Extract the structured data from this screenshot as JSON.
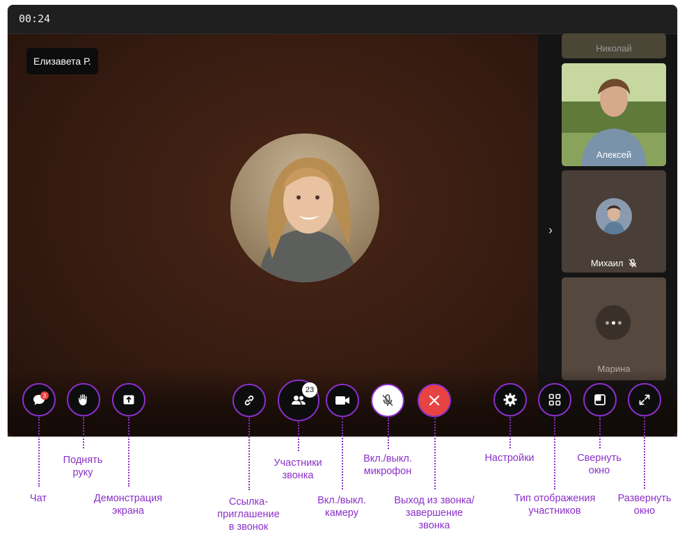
{
  "call": {
    "timer": "00:24",
    "active_speaker": "Елизавета Р."
  },
  "participants": [
    {
      "name": "Николай",
      "view": "video"
    },
    {
      "name": "Алексей",
      "view": "video"
    },
    {
      "name": "Михаил",
      "view": "avatar",
      "muted": true
    },
    {
      "name": "Марина",
      "view": "connecting"
    }
  ],
  "controls": {
    "chat": {
      "badge": "3",
      "caption": "Чат",
      "icon": "chat-icon"
    },
    "raise_hand": {
      "caption": "Поднять\nруку",
      "icon": "hand-icon"
    },
    "screen_share": {
      "caption": "Демонстрация\nэкрана",
      "icon": "share-screen-icon"
    },
    "invite_link": {
      "caption": "Ссылка-\nприглашение\nв звонок",
      "icon": "link-icon"
    },
    "participants": {
      "badge": "23",
      "caption": "Участники\nзвонка",
      "icon": "people-icon"
    },
    "camera": {
      "caption": "Вкл./выкл.\nкамеру",
      "icon": "camera-icon"
    },
    "microphone": {
      "caption": "Вкл./выкл.\nмикрофон",
      "icon": "mic-off-icon"
    },
    "end_call": {
      "caption": "Выход из звонка/\nзавершение\nзвонка",
      "icon": "close-icon"
    },
    "settings": {
      "caption": "Настройки",
      "icon": "gear-icon"
    },
    "layout": {
      "caption": "Тип отображения\nучастников",
      "icon": "grid-icon"
    },
    "minimize": {
      "caption": "Свернуть\nокно",
      "icon": "minimize-window-icon"
    },
    "fullscreen": {
      "caption": "Развернуть\nокно",
      "icon": "expand-icon"
    }
  },
  "colors": {
    "accent": "#8b2fc9",
    "end_call": "#e84343",
    "window": "#141414",
    "stage": "#3a1d12"
  }
}
